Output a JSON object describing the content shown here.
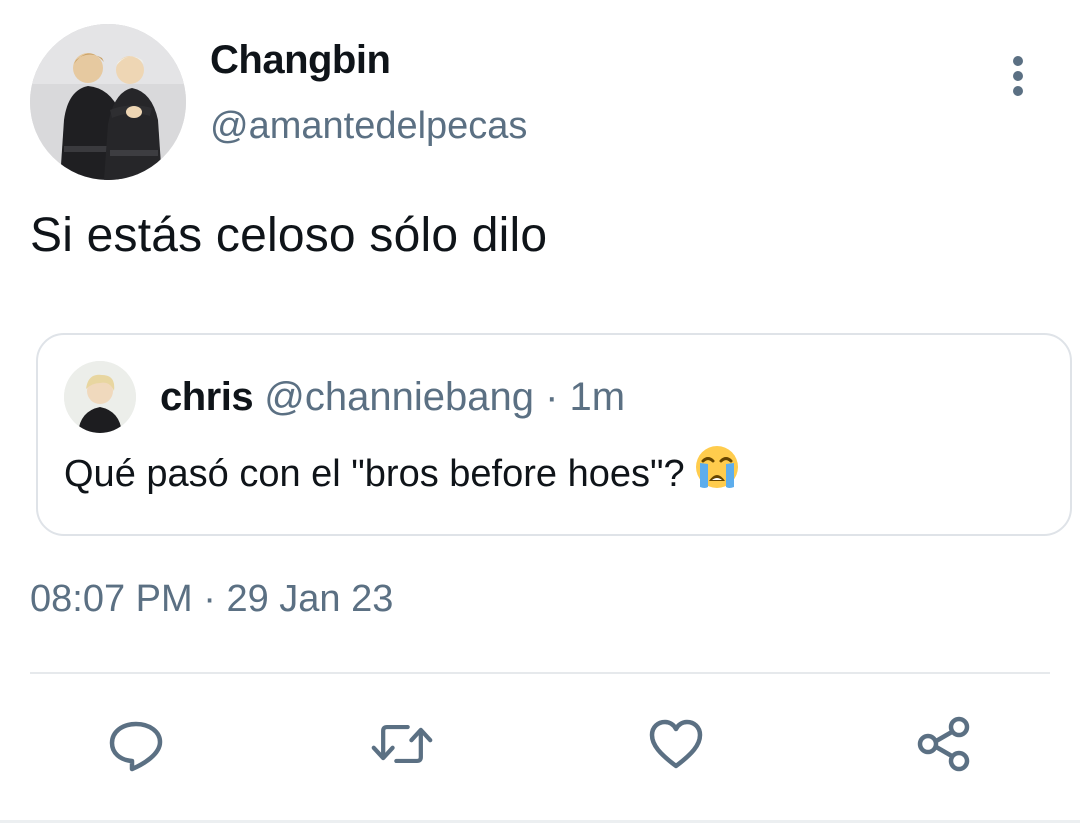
{
  "tweet": {
    "author_name": "Changbin",
    "author_handle": "@amantedelpecas",
    "text": "Si estás celoso sólo dilo",
    "timestamp_time": "08:07 PM",
    "timestamp_sep": "·",
    "timestamp_date": "29 Jan 23"
  },
  "quoted_tweet": {
    "author_name": "chris",
    "author_handle": "@channiebang",
    "sep": "·",
    "time": "1m",
    "text": "Qué pasó con el \"bros before hoes\"?",
    "emoji": "loudly-crying-face"
  },
  "icons": {
    "more": "more-vertical-icon",
    "reply": "reply-icon",
    "retweet": "retweet-icon",
    "like": "heart-icon",
    "share": "share-icon"
  },
  "colors": {
    "text_primary": "#0f1419",
    "text_secondary": "#5b7083",
    "border": "#dfe3e8"
  }
}
